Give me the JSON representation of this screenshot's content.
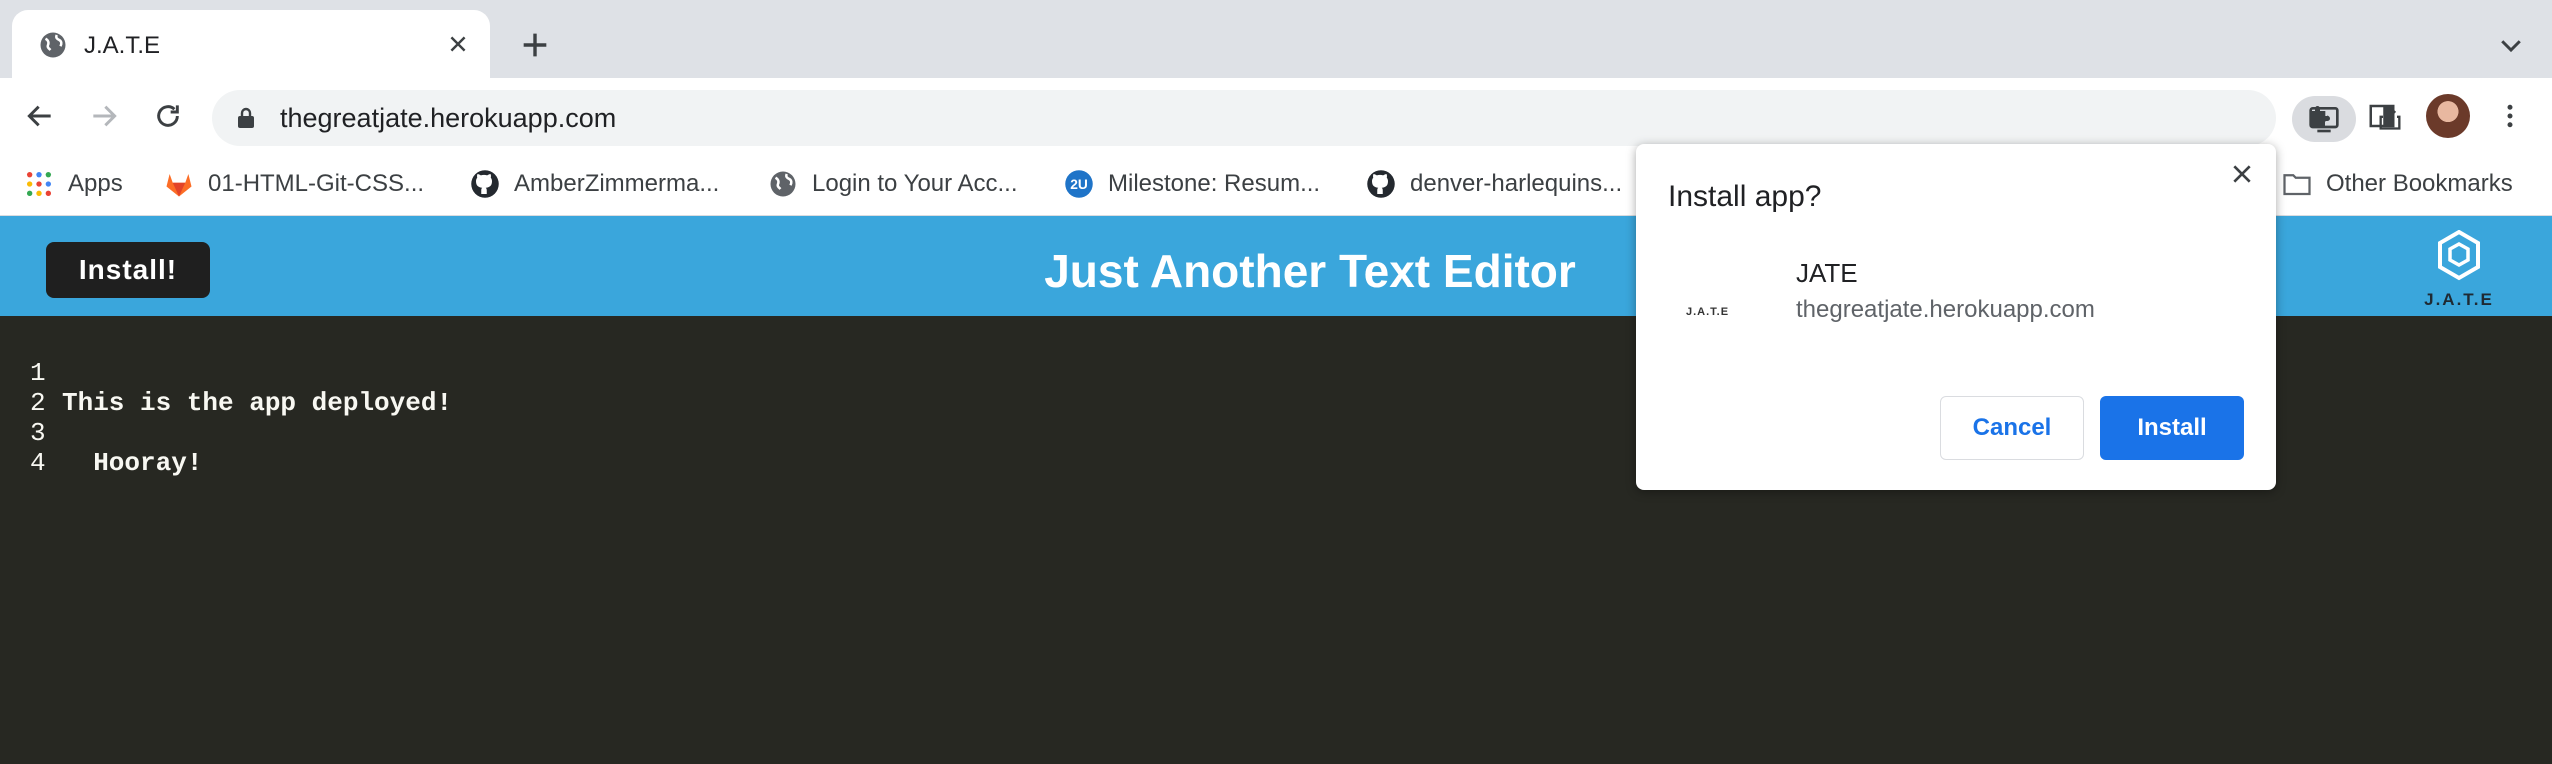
{
  "browser": {
    "tab": {
      "title": "J.A.T.E",
      "close_icon": "close-icon"
    },
    "address_bar": {
      "url": "thegreatjate.herokuapp.com"
    },
    "bookmarks": [
      {
        "label": "Apps",
        "icon": "apps-grid-icon"
      },
      {
        "label": "01-HTML-Git-CSS...",
        "icon": "gitlab-icon"
      },
      {
        "label": "AmberZimmerma...",
        "icon": "github-icon"
      },
      {
        "label": "Login to Your Acc...",
        "icon": "globe-icon"
      },
      {
        "label": "Milestone: Resum...",
        "icon": "2u-icon"
      },
      {
        "label": "denver-harlequins...",
        "icon": "github-icon"
      },
      {
        "label": "Other Bookmarks",
        "icon": "folder-icon"
      }
    ]
  },
  "app": {
    "install_button": "Install!",
    "title": "Just Another Text Editor",
    "logo_text": "J.A.T.E"
  },
  "editor": {
    "lines": [
      {
        "num": "1",
        "text": "This is the app deployed!"
      },
      {
        "num": "2",
        "text": ""
      },
      {
        "num": "3",
        "text": "  Hooray!"
      },
      {
        "num": "4",
        "text": ""
      }
    ]
  },
  "install_dialog": {
    "title": "Install app?",
    "app_icon_text": "J.A.T.E",
    "app_name": "JATE",
    "app_origin": "thegreatjate.herokuapp.com",
    "cancel_label": "Cancel",
    "install_label": "Install"
  },
  "colors": {
    "header_bg": "#3aa6dc",
    "editor_bg": "#272822",
    "primary_button": "#1a73e8"
  }
}
